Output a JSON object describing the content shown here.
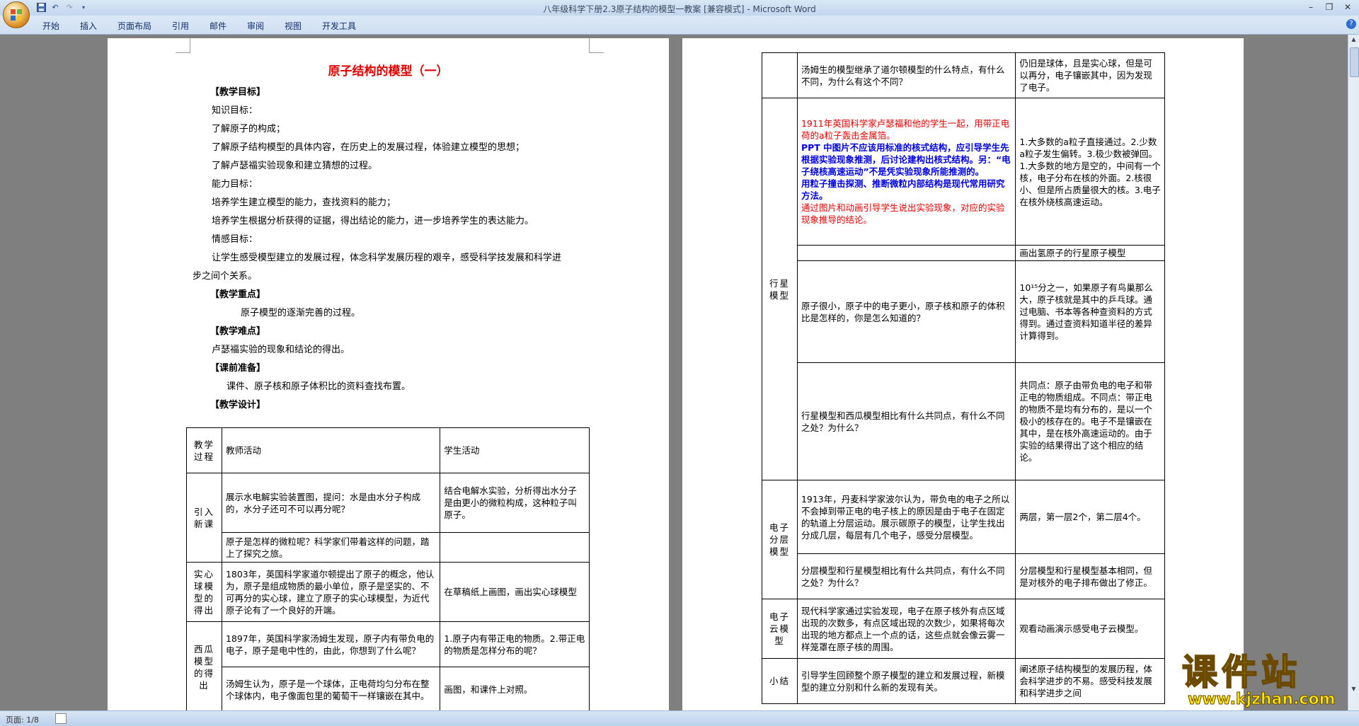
{
  "app": {
    "window_title": "八年级科学下册2.3原子结构的模型一教案 [兼容模式] - Microsoft Word",
    "help_label": "?"
  },
  "ribbon": {
    "tabs": [
      "开始",
      "插入",
      "页面布局",
      "引用",
      "邮件",
      "审阅",
      "视图",
      "开发工具"
    ]
  },
  "status": {
    "page": "页面: 1/8"
  },
  "watermark": {
    "main": "课件站",
    "url": "www.kjzhan.com"
  },
  "page1": {
    "title": "原子结构的模型（一）",
    "lines": [
      "【教学目标】",
      "知识目标：",
      "了解原子的构成；",
      "了解原子结构模型的具体内容，在历史上的发展过程，体验建立模型的思想；",
      "了解卢瑟福实验现象和建立猜想的过程。",
      "能力目标：",
      "培养学生建立模型的能力，查找资料的能力；",
      "培养学生根据分析获得的证据，得出结论的能力，进一步培养学生的表达能力。",
      "情感目标：",
      "让学生感受模型建立的发展过程，体念科学发展历程的艰辛，感受科学技发展和科学进",
      "步之间个关系。",
      "【教学重点】",
      "原子模型的逐渐完善的过程。",
      "【教学难点】",
      "卢瑟福实验的现象和结论的得出。",
      "【课前准备】",
      "课件、原子核和原子体积比的资料查找布置。",
      "【教学设计】"
    ],
    "table": {
      "headers": [
        "教学过程",
        "教师活动",
        "学生活动"
      ],
      "rows": [
        {
          "stage": "引入新课",
          "teacher": "展示水电解实验装置图，提问：水是由水分子构成的，水分子还可不可以再分呢？",
          "student": "结合电解水实验，分析得出水分子是由更小的微粒构成，这种粒子叫原子。"
        },
        {
          "stage": "",
          "teacher": "原子是怎样的微粒呢？科学家们带着这样的问题，踏上了探究之旅。",
          "student": ""
        },
        {
          "stage": "实心球模型的得出",
          "teacher": "1803年，英国科学家道尔顿提出了原子的概念，他认为，原子是组成物质的最小单位，原子是坚实的、不可再分的实心球，建立了原子的实心球模型，为近代原子论有了一个良好的开端。",
          "student": "在草稿纸上画图，画出实心球模型"
        },
        {
          "stage": "西瓜模型的得出",
          "teacher": "1897年，英国科学家汤姆生发现，原子内有带负电的电子，原子是电中性的，由此，你想到了什么呢？",
          "student": "1.原子内有带正电的物质。2.带正电的物质是怎样分布的呢？"
        },
        {
          "stage": "",
          "teacher": "汤姆生认为，原子是一个球体，正电荷均匀分布在整个球体内，电子像面包里的葡萄干一样镶嵌在其中。",
          "student": "画图，和课件上对照。"
        }
      ]
    }
  },
  "page2": {
    "rows": {
      "r1_teacher": "汤姆生的模型继承了道尔顿模型的什么特点，有什么不同，为什么有这个不同？",
      "r1_student": "仍旧是球体，且是实心球，但是可以再分，电子镶嵌其中，因为发现了电子。",
      "r2_teacher_red1": "1911年英国科学家卢瑟福和他的学生一起，用带正电荷的a粒子轰击金属箔。",
      "r2_teacher_blue1": "PPT 中图片不应该用标准的核式结构，应引导学生先根据实验现象推测，后讨论建构出核式结构。另：“电子绕核高速运动”不是凭实验现象所能推测的。",
      "r2_teacher_blue2": "用粒子撞击探测、推断微粒内部结构是现代常用研究方法。",
      "r2_teacher_red2": "通过图片和动画引导学生说出实验现象，对应的实验现象推导的结论。",
      "r2_student": "1.大多数的a粒子直接通过。2.少数a粒子发生偏转。3.极少数被弹回。1.大多数的地方是空的，中间有一个核，电子分布在核的外面。2.核很小、但是所占质量很大的核。3.电子在核外绕核高速运动。",
      "stage_planet": "行星模型",
      "r3_student": "画出氢原子的行星原子模型",
      "r4_teacher": "原子很小，原子中的电子更小，原子核和原子的体积比是怎样的，你是怎么知道的？",
      "r4_student": "10¹⁵分之一，如果原子有鸟巢那么大，原子核就是其中的乒乓球。通过电脑、书本等各种查资料的方式得到。通过查资料知道半径的差异计算得到。",
      "r5_teacher": "行星模型和西瓜模型相比有什么共同点，有什么不同之处？为什么？",
      "r5_student": "共同点：原子由带负电的电子和带正电的物质组成。不同点：带正电的物质不是均有分布的，是以一个极小的核存在的。电子不是镶嵌在其中，是在核外高速运动的。由于实验的结果得出了这个相应的结论。",
      "stage_layer": "电子分层模型",
      "r6_teacher": "1913年，丹麦科学家波尔认为，带负电的电子之所以不会掉到带正电的电子核上的原因是由于电子在固定的轨道上分层运动。展示碳原子的模型，让学生找出分成几层，每层有几个电子，感受分层模型。",
      "r6_student": "两层，第一层2个，第二层4个。",
      "r7_teacher": "分层模型和行星模型相比有什么共同点，有什么不同之处？为什么？",
      "r7_student": "分层模型和行星模型基本相同，但是对核外的电子排布做出了修正。",
      "stage_cloud": "电子云模型",
      "r8_teacher": "现代科学家通过实验发现，电子在原子核外有点区域出现的次数多，有点区域出现的次数少，如果将每次出现的地方都点上一个点的话，这些点就会像云雾一样笼罩在原子核的周围。",
      "r8_student": "观看动画演示感受电子云模型。",
      "stage_summary": "小结",
      "r9_teacher": "引导学生回顾整个原子模型的建立和发展过程，新模型的建立分别和什么新的发现有关。",
      "r9_student": "阐述原子结构模型的发展历程，体会科学进步的不易。感受科技发展和科学进步之间"
    }
  }
}
